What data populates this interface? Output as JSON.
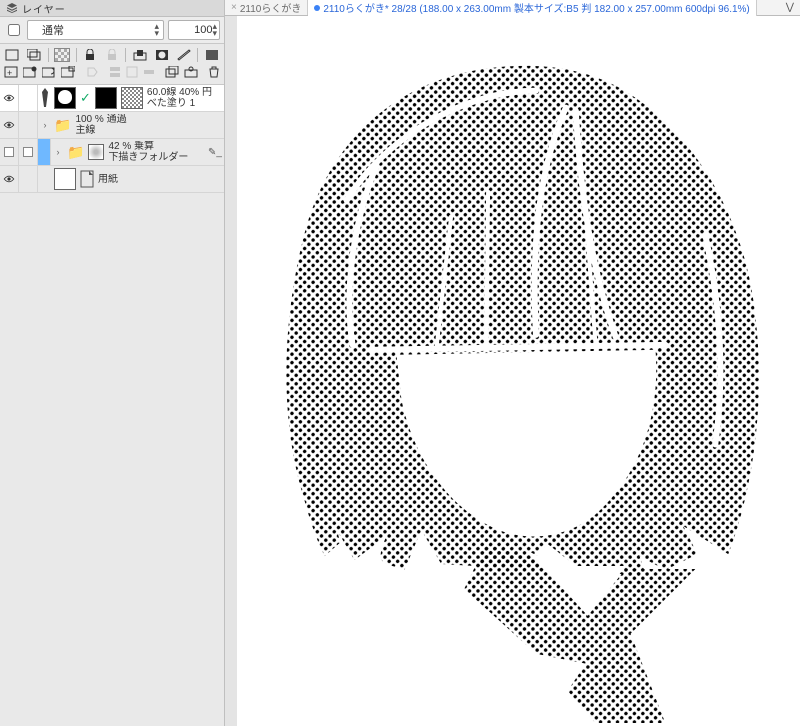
{
  "panel": {
    "title": "レイヤー",
    "blend_mode": "通常",
    "opacity": "100",
    "tools": {
      "r1": [
        "new-layer",
        "new-layer-2",
        "sep",
        "checker",
        "sep",
        "lock",
        "lock-alpha",
        "sep",
        "mask-clip",
        "mask",
        "ruler",
        "sep",
        "layer-color"
      ],
      "r2": [
        "new-raster",
        "new-vector",
        "new-ref",
        "new-frame",
        "sep",
        "link",
        "sep",
        "fx1",
        "fx2",
        "fx3",
        "sep",
        "combine",
        "light-table",
        "sep",
        "trash"
      ]
    }
  },
  "layers": [
    {
      "id": "tone",
      "visible": true,
      "selected": true,
      "l1": "60.0線 40% 円",
      "l2": "べた塗り 1"
    },
    {
      "id": "folder-senga",
      "visible": true,
      "l1": "100 %  通過",
      "l2": "主線"
    },
    {
      "id": "folder-shita",
      "color": "blue",
      "l1": "42 %  乗算",
      "l2": "下描きフォルダー"
    },
    {
      "id": "paper",
      "visible": true,
      "l1": "",
      "l2": "用紙"
    }
  ],
  "tabs": {
    "inactive": "2110らくがき",
    "active": "2110らくがき* 28/28 (188.00 x 263.00mm 製本サイズ:B5 判 182.00 x 257.00mm 600dpi 96.1%)"
  }
}
